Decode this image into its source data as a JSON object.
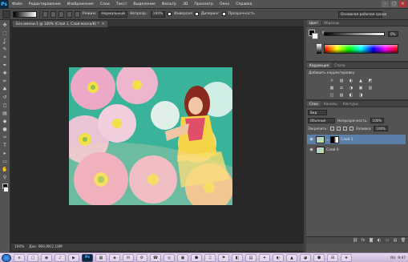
{
  "app": {
    "logo": "Ps"
  },
  "menu": [
    "Файл",
    "Редактирование",
    "Изображение",
    "Слои",
    "Текст",
    "Выделение",
    "Фильтр",
    "3D",
    "Просмотр",
    "Окно",
    "Справка"
  ],
  "window_controls": [
    "–",
    "□",
    "✕"
  ],
  "options": {
    "mode_label": "Режим:",
    "mode_value": "Нормальный",
    "opacity_label": "Непрозр.:",
    "opacity_value": "100%",
    "inversion_label": "Инверсия",
    "dither_label": "Дизеринг",
    "transparency_label": "Прозрачность",
    "workspace_value": "Основная рабочая среда"
  },
  "toolbox_icons": [
    "move-icon",
    "marquee-icon",
    "lasso-icon",
    "quick-select-icon",
    "crop-icon",
    "eyedropper-icon",
    "healing-icon",
    "brush-icon",
    "stamp-icon",
    "history-brush-icon",
    "eraser-icon",
    "gradient-icon",
    "blur-icon",
    "dodge-icon",
    "pen-icon",
    "type-icon",
    "path-select-icon",
    "shape-icon",
    "hand-icon",
    "zoom-icon"
  ],
  "toolbox_glyphs": [
    "✥",
    "⬚",
    "ʆ",
    "✎",
    "⌗",
    "✒",
    "✚",
    "✏",
    "♣",
    "↺",
    "◻",
    "▤",
    "◆",
    "●",
    "✑",
    "T",
    "▸",
    "▭",
    "✋",
    "⚲"
  ],
  "document": {
    "tab_label": "Без имени-1 @ 100% (Слой 1, Слой-маска/8) *",
    "close": "✕"
  },
  "status": {
    "zoom": "100%",
    "doc_info": "Док: 960,9K/2,18M"
  },
  "color_panel": {
    "tabs": [
      "Цвет",
      "Образцы"
    ],
    "channel_label": "K",
    "channel_value": "0",
    "value_unit": "%"
  },
  "adjustments_panel": {
    "tabs": [
      "Коррекция",
      "Стили"
    ],
    "title": "Добавить корректировку",
    "icons": [
      "☼",
      "▨",
      "◐",
      "▲",
      "◩",
      "▦",
      "⚖",
      "◑",
      "▣",
      "▥",
      "◫",
      "▧",
      "◧",
      "◨"
    ]
  },
  "layers_panel": {
    "tabs": [
      "Слои",
      "Каналы",
      "Контуры"
    ],
    "kind_value": "Вид",
    "blend_value": "Обычные",
    "opacity_label": "Непрозрачность:",
    "opacity_value": "100%",
    "lock_label": "Закрепить:",
    "fill_label": "Заливка:",
    "fill_value": "100%",
    "layers": [
      {
        "name": "Слой 1",
        "selected": true
      },
      {
        "name": "Слой 0",
        "selected": false
      }
    ],
    "footer_icons": [
      "⛓",
      "fx",
      "◙",
      "◐",
      "▭",
      "▤",
      "🗑"
    ]
  },
  "taskbar": {
    "apps": [
      "e",
      "▢",
      "◉",
      "♪",
      "▶",
      "Ps",
      "▦",
      "◈",
      "✉",
      "⚙",
      "☎",
      "◎",
      "▣",
      "⬣",
      "♫",
      "⚑",
      "◧",
      "▤",
      "✦",
      "◐",
      "▲",
      "◕",
      "⬢",
      "⊞",
      "★"
    ],
    "tray_lang": "RU",
    "time": "9:47"
  }
}
